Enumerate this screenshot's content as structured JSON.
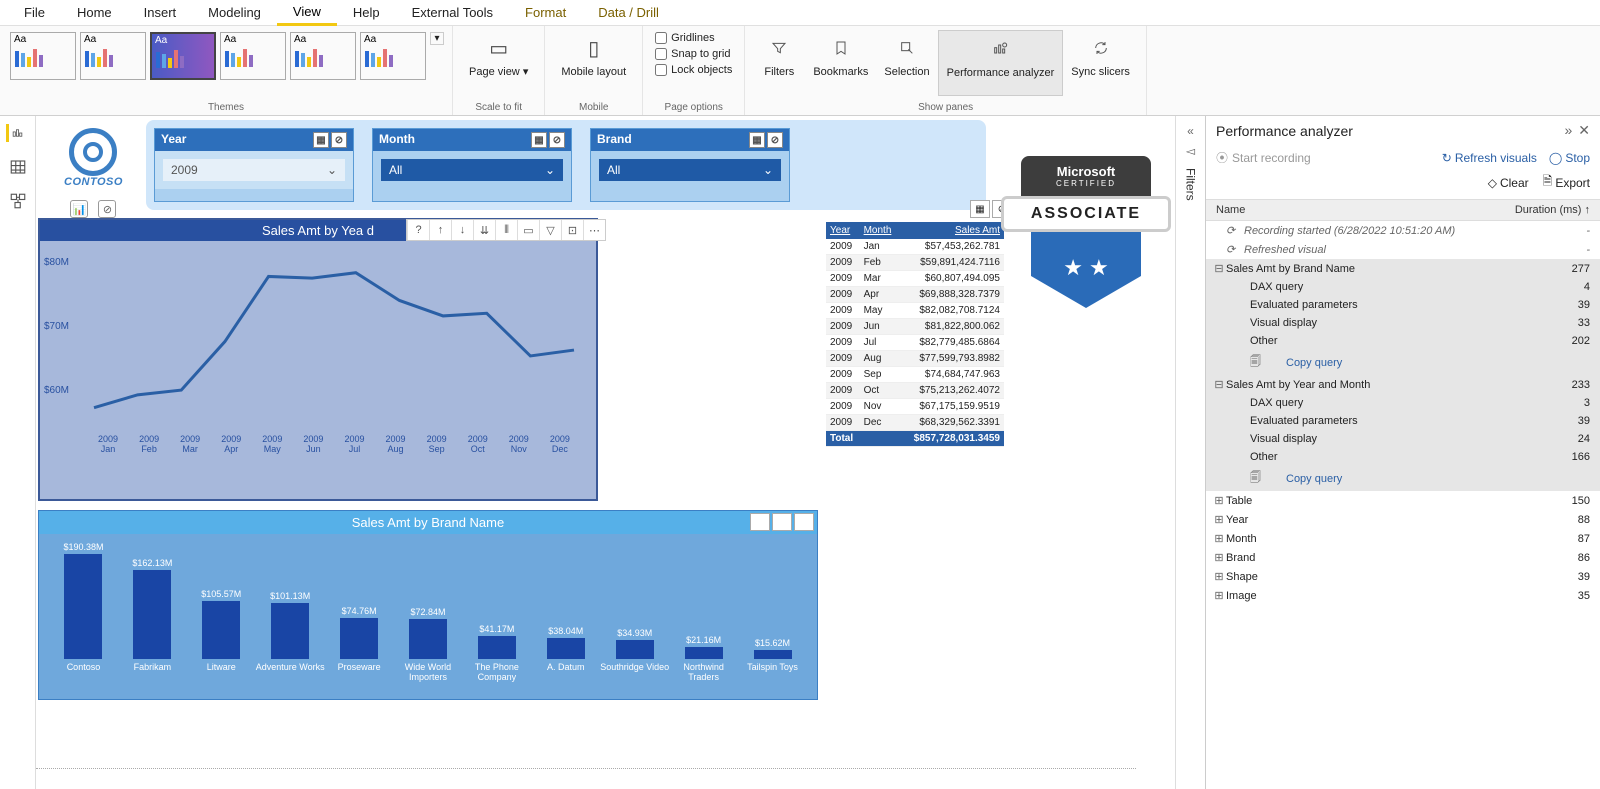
{
  "menu": {
    "file": "File",
    "home": "Home",
    "insert": "Insert",
    "modeling": "Modeling",
    "view": "View",
    "help": "Help",
    "external": "External Tools",
    "format": "Format",
    "datadrill": "Data / Drill"
  },
  "ribbon": {
    "themes_label": "Themes",
    "pageview": "Page view",
    "mobile": "Mobile layout",
    "scale_label": "Scale to fit",
    "mobile_label": "Mobile",
    "gridlines": "Gridlines",
    "snap": "Snap to grid",
    "lock": "Lock objects",
    "pageopt_label": "Page options",
    "filters": "Filters",
    "bookmarks": "Bookmarks",
    "selection": "Selection",
    "perf": "Performance analyzer",
    "sync": "Sync slicers",
    "showpanes_label": "Show panes"
  },
  "logo": {
    "brand": "CONTOSO"
  },
  "slicers": {
    "year": {
      "title": "Year",
      "value": "2009"
    },
    "month": {
      "title": "Month",
      "value": "All"
    },
    "brand": {
      "title": "Brand",
      "value": "All"
    }
  },
  "chart_data": [
    {
      "type": "line",
      "title": "Sales Amt by Year and Month",
      "title_short": "Sales Amt by Yea      d",
      "ylabel": "",
      "xlabel": "",
      "yticks": [
        "$80M",
        "$70M",
        "$60M"
      ],
      "categories": [
        {
          "yr": "2009",
          "mo": "Jan"
        },
        {
          "yr": "2009",
          "mo": "Feb"
        },
        {
          "yr": "2009",
          "mo": "Mar"
        },
        {
          "yr": "2009",
          "mo": "Apr"
        },
        {
          "yr": "2009",
          "mo": "May"
        },
        {
          "yr": "2009",
          "mo": "Jun"
        },
        {
          "yr": "2009",
          "mo": "Jul"
        },
        {
          "yr": "2009",
          "mo": "Aug"
        },
        {
          "yr": "2009",
          "mo": "Sep"
        },
        {
          "yr": "2009",
          "mo": "Oct"
        },
        {
          "yr": "2009",
          "mo": "Nov"
        },
        {
          "yr": "2009",
          "mo": "Dec"
        }
      ],
      "values": [
        57.5,
        59.9,
        60.8,
        69.9,
        82.1,
        81.8,
        82.8,
        77.6,
        74.7,
        75.2,
        67.2,
        68.3
      ],
      "ylim": [
        55,
        85
      ]
    },
    {
      "type": "bar",
      "title": "Sales Amt by Brand Name",
      "categories": [
        "Contoso",
        "Fabrikam",
        "Litware",
        "Adventure Works",
        "Proseware",
        "Wide World Importers",
        "The Phone Company",
        "A. Datum",
        "Southridge Video",
        "Northwind Traders",
        "Tailspin Toys"
      ],
      "labels": [
        "$190.38M",
        "$162.13M",
        "$105.57M",
        "$101.13M",
        "$74.76M",
        "$72.84M",
        "$41.17M",
        "$38.04M",
        "$34.93M",
        "$21.16M",
        "$15.62M"
      ],
      "values": [
        190.38,
        162.13,
        105.57,
        101.13,
        74.76,
        72.84,
        41.17,
        38.04,
        34.93,
        21.16,
        15.62
      ],
      "ylim": [
        0,
        200
      ]
    }
  ],
  "table": {
    "headers": [
      "Year",
      "Month",
      "Sales Amt"
    ],
    "rows": [
      [
        "2009",
        "Jan",
        "$57,453,262.781"
      ],
      [
        "2009",
        "Feb",
        "$59,891,424.7116"
      ],
      [
        "2009",
        "Mar",
        "$60,807,494.095"
      ],
      [
        "2009",
        "Apr",
        "$69,888,328.7379"
      ],
      [
        "2009",
        "May",
        "$82,082,708.7124"
      ],
      [
        "2009",
        "Jun",
        "$81,822,800.062"
      ],
      [
        "2009",
        "Jul",
        "$82,779,485.6864"
      ],
      [
        "2009",
        "Aug",
        "$77,599,793.8982"
      ],
      [
        "2009",
        "Sep",
        "$74,684,747.963"
      ],
      [
        "2009",
        "Oct",
        "$75,213,262.4072"
      ],
      [
        "2009",
        "Nov",
        "$67,175,159.9519"
      ],
      [
        "2009",
        "Dec",
        "$68,329,562.3391"
      ]
    ],
    "total_label": "Total",
    "total_value": "$857,728,031.3459"
  },
  "badge": {
    "l1": "Microsoft",
    "l2": "CERTIFIED",
    "l3": "ASSOCIATE"
  },
  "filters_pane": "Filters",
  "perf": {
    "title": "Performance analyzer",
    "start": "Start recording",
    "refresh": "Refresh visuals",
    "stop": "Stop",
    "clear": "Clear",
    "export": "Export",
    "col_name": "Name",
    "col_dur": "Duration (ms)",
    "copy": "Copy query",
    "rows_meta": [
      {
        "t": "meta",
        "exp": "",
        "ico": "⟳",
        "name": "Recording started (6/28/2022 10:51:20 AM)",
        "dur": "-"
      },
      {
        "t": "meta",
        "exp": "",
        "ico": "⟳",
        "name": "Refreshed visual",
        "dur": "-"
      }
    ],
    "tree": [
      {
        "exp": "⊟",
        "name": "Sales Amt by Brand Name",
        "dur": "277",
        "children": [
          {
            "name": "DAX query",
            "dur": "4"
          },
          {
            "name": "Evaluated parameters",
            "dur": "39"
          },
          {
            "name": "Visual display",
            "dur": "33"
          },
          {
            "name": "Other",
            "dur": "202"
          },
          {
            "name": "copy"
          }
        ]
      },
      {
        "exp": "⊟",
        "name": "Sales Amt by Year and Month",
        "dur": "233",
        "children": [
          {
            "name": "DAX query",
            "dur": "3"
          },
          {
            "name": "Evaluated parameters",
            "dur": "39"
          },
          {
            "name": "Visual display",
            "dur": "24"
          },
          {
            "name": "Other",
            "dur": "166"
          },
          {
            "name": "copy"
          }
        ]
      },
      {
        "exp": "⊞",
        "name": "Table",
        "dur": "150"
      },
      {
        "exp": "⊞",
        "name": "Year",
        "dur": "88"
      },
      {
        "exp": "⊞",
        "name": "Month",
        "dur": "87"
      },
      {
        "exp": "⊞",
        "name": "Brand",
        "dur": "86"
      },
      {
        "exp": "⊞",
        "name": "Shape",
        "dur": "39"
      },
      {
        "exp": "⊞",
        "name": "Image",
        "dur": "35"
      }
    ]
  }
}
